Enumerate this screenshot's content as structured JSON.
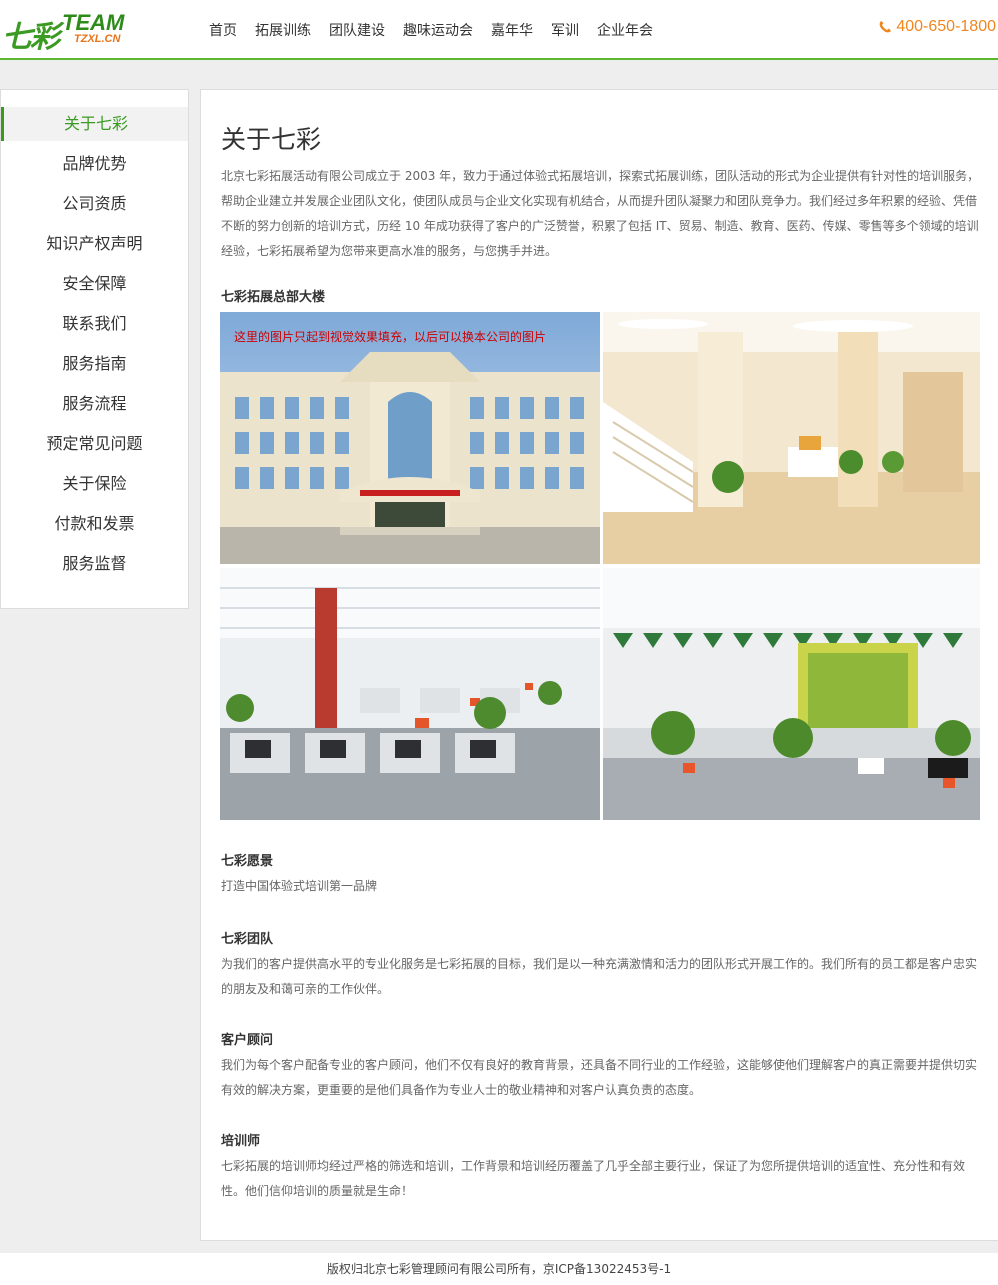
{
  "header": {
    "logo": {
      "cn": "七彩",
      "en": "TEAM",
      "sub": "TZXL.CN"
    },
    "nav": [
      "首页",
      "拓展训练",
      "团队建设",
      "趣味运动会",
      "嘉年华",
      "军训",
      "企业年会"
    ],
    "phone": "400-650-1800",
    "accent_color": "#5cb82e",
    "phone_color": "#f0861e"
  },
  "sidebar": {
    "items": [
      "关于七彩",
      "品牌优势",
      "公司资质",
      "知识产权声明",
      "安全保障",
      "联系我们",
      "服务指南",
      "服务流程",
      "预定常见问题",
      "关于保险",
      "付款和发票",
      "服务监督"
    ],
    "active_index": 0
  },
  "main": {
    "title": "关于七彩",
    "intro": "北京七彩拓展活动有限公司成立于 2003 年，致力于通过体验式拓展培训，探索式拓展训练，团队活动的形式为企业提供有针对性的培训服务，帮助企业建立并发展企业团队文化，使团队成员与企业文化实现有机结合，从而提升团队凝聚力和团队竞争力。我们经过多年积累的经验、凭借不断的努力创新的培训方式，历经 10 年成功获得了客户的广泛赞誉，积累了包括 IT、贸易、制造、教育、医药、传媒、零售等多个领域的培训经验，七彩拓展希望为您带来更高水准的服务，与您携手并进。",
    "hq_heading": "七彩拓展总部大楼",
    "photo_caption": "这里的图片只起到视觉效果填充，以后可以换本公司的图片",
    "sections": [
      {
        "heading": "七彩愿景",
        "text": "打造中国体验式培训第一品牌"
      },
      {
        "heading": "七彩团队",
        "text": "为我们的客户提供高水平的专业化服务是七彩拓展的目标，我们是以一种充满激情和活力的团队形式开展工作的。我们所有的员工都是客户忠实的朋友及和蔼可亲的工作伙伴。"
      },
      {
        "heading": "客户顾问",
        "text": "我们为每个客户配备专业的客户顾问，他们不仅有良好的教育背景，还具备不同行业的工作经验，这能够使他们理解客户的真正需要并提供切实有效的解决方案，更重要的是他们具备作为专业人士的敬业精神和对客户认真负责的态度。"
      },
      {
        "heading": "培训师",
        "text": "七彩拓展的培训师均经过严格的筛选和培训，工作背景和培训经历覆盖了几乎全部主要行业，保证了为您所提供培训的适宜性、充分性和有效性。他们信仰培训的质量就是生命！"
      }
    ]
  },
  "footer": {
    "text": "版权归北京七彩管理顾问有限公司所有，京ICP备13022453号-1"
  }
}
